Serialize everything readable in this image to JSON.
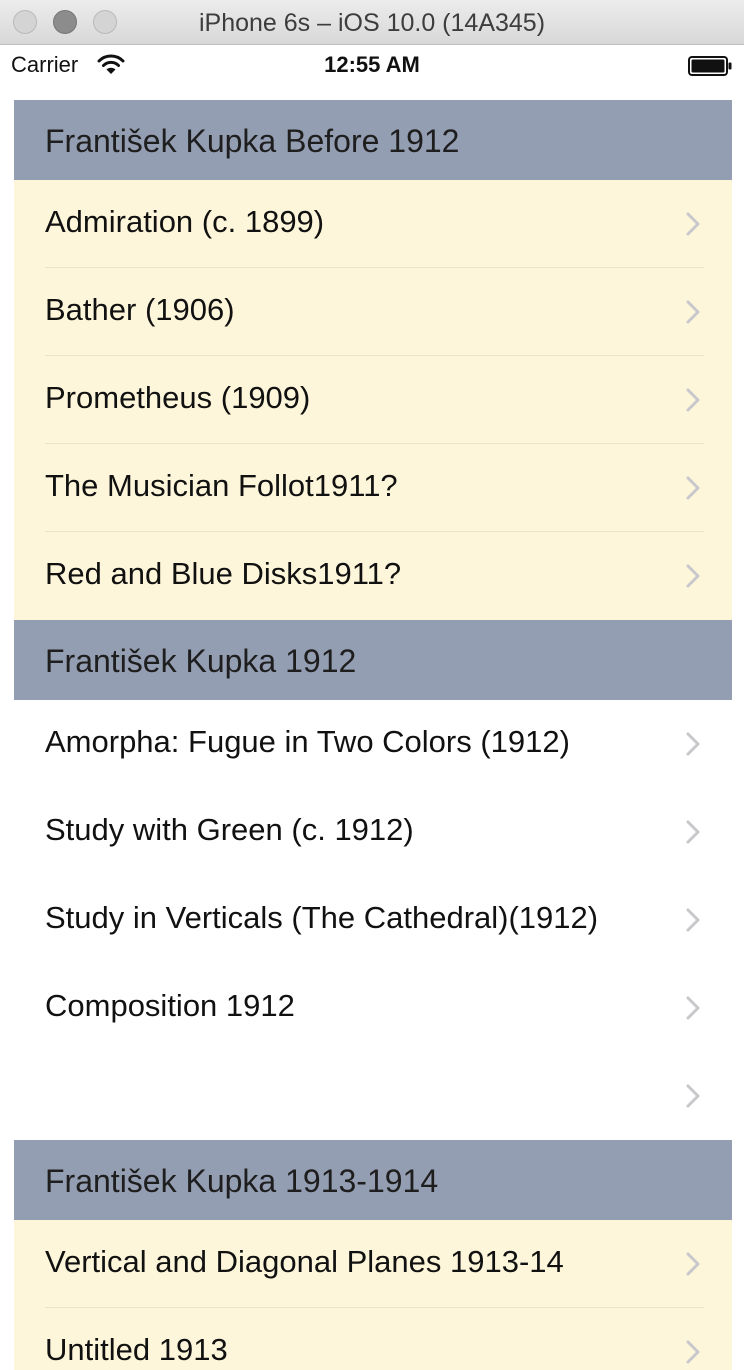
{
  "window": {
    "title": "iPhone 6s – iOS 10.0 (14A345)"
  },
  "status_bar": {
    "carrier": "Carrier",
    "time": "12:55 AM"
  },
  "sections": [
    {
      "title": "František Kupka Before 1912",
      "rows": [
        "Admiration (c. 1899)",
        "Bather (1906)",
        "Prometheus (1909)",
        "The Musician Follot1911?",
        "Red and Blue Disks1911?"
      ]
    },
    {
      "title": "František Kupka 1912",
      "rows": [
        "Amorpha: Fugue in Two Colors (1912)",
        "Study with Green (c. 1912)",
        "Study in Verticals (The Cathedral)(1912)",
        "Composition 1912",
        ""
      ]
    },
    {
      "title": "František Kupka 1913-1914",
      "rows": [
        "Vertical and Diagonal Planes 1913-14",
        "Untitled 1913"
      ]
    }
  ],
  "colors": {
    "header_bg": "#949eb2",
    "cream_row_bg": "#fef6da",
    "white_row_bg": "#ffffff",
    "chevron": "#c7c7cc"
  },
  "icons": {
    "row_accessory": "chevron-right-icon",
    "wifi": "wifi-icon",
    "battery": "battery-icon"
  }
}
